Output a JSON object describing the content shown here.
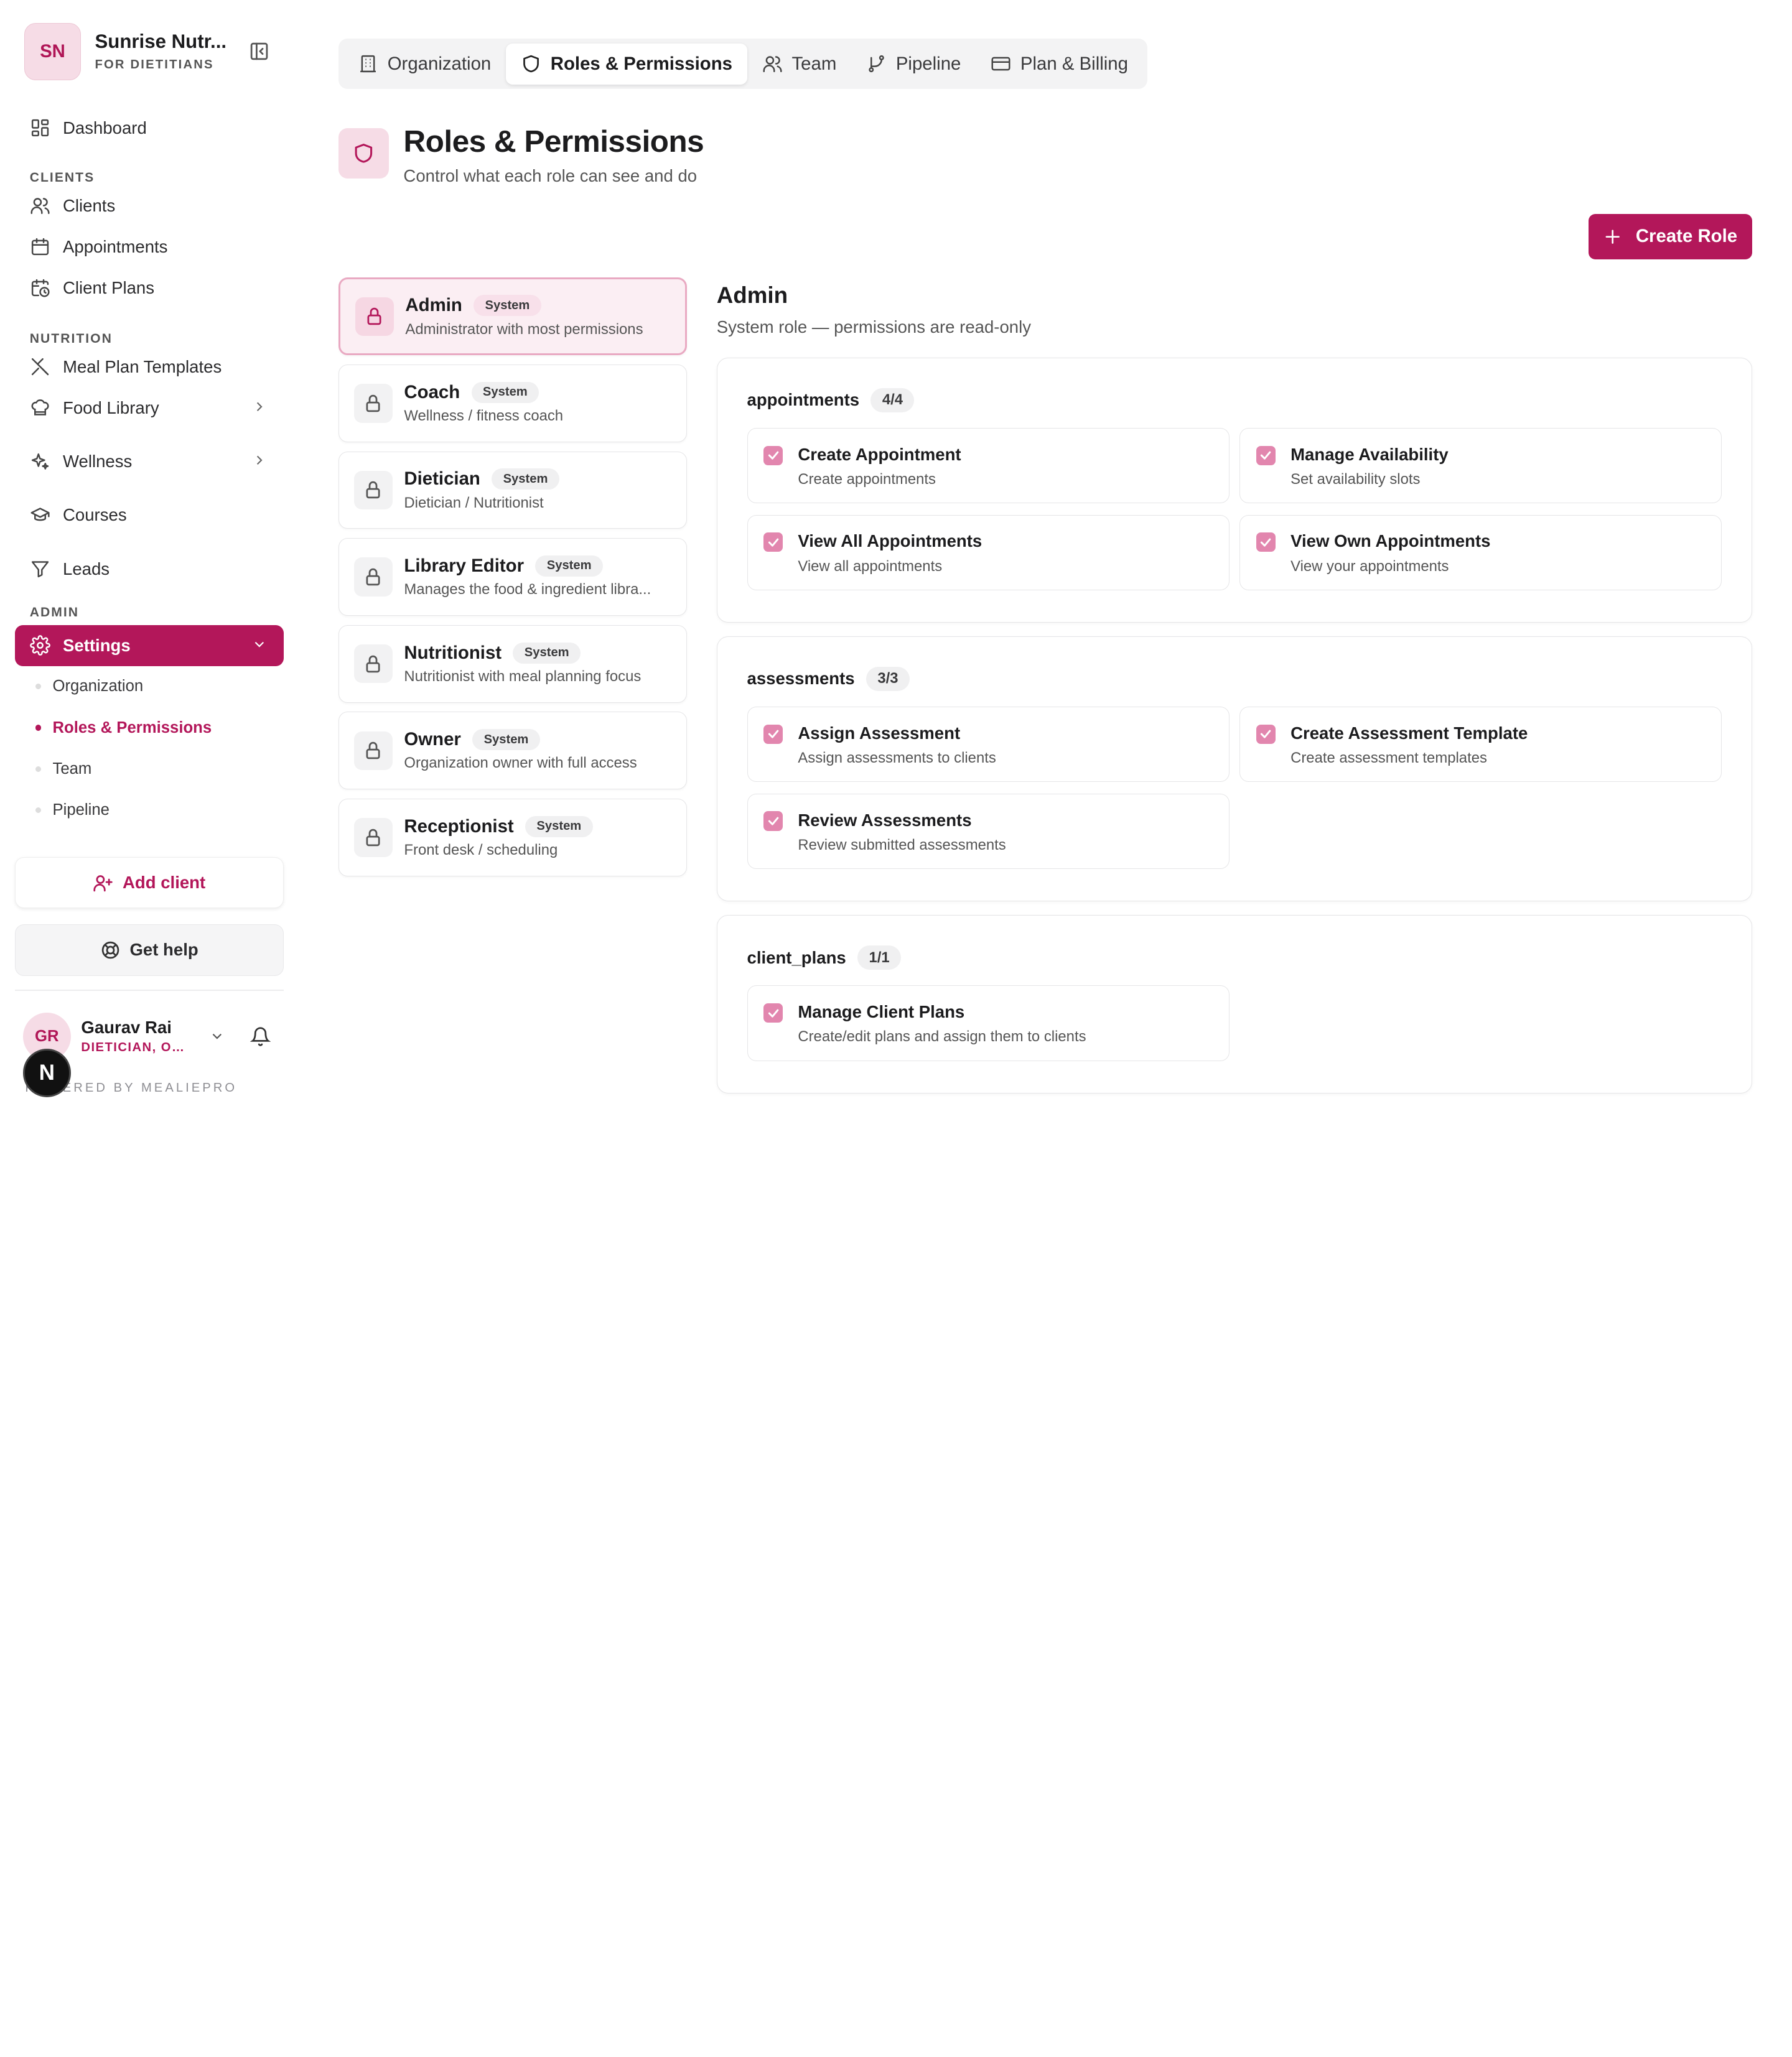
{
  "brand": {
    "initials": "SN",
    "name": "Sunrise Nutr...",
    "subtitle": "FOR DIETITIANS"
  },
  "nav": {
    "dashboard": "Dashboard",
    "clients_label": "CLIENTS",
    "clients": "Clients",
    "appointments": "Appointments",
    "client_plans": "Client Plans",
    "nutrition_label": "NUTRITION",
    "meal_plan_templates": "Meal Plan Templates",
    "food_library": "Food Library",
    "wellness": "Wellness",
    "courses": "Courses",
    "leads": "Leads",
    "admin_label": "ADMIN",
    "settings": "Settings",
    "sub": {
      "organization": "Organization",
      "roles": "Roles & Permissions",
      "team": "Team",
      "pipeline": "Pipeline"
    }
  },
  "sidebar_buttons": {
    "add_client": "Add client",
    "get_help": "Get help"
  },
  "user": {
    "initials": "GR",
    "name": "Gaurav Rai",
    "role": "DIETICIAN, OW..."
  },
  "powered_by": "POWERED BY MEALIEPRO",
  "next_badge": "N",
  "tabs": [
    "Organization",
    "Roles & Permissions",
    "Team",
    "Pipeline",
    "Plan & Billing"
  ],
  "page": {
    "title": "Roles & Permissions",
    "subtitle": "Control what each role can see and do"
  },
  "create_role": "Create Role",
  "roles": [
    {
      "name": "Admin",
      "badge": "System",
      "desc": "Administrator with most permissions"
    },
    {
      "name": "Coach",
      "badge": "System",
      "desc": "Wellness / fitness coach"
    },
    {
      "name": "Dietician",
      "badge": "System",
      "desc": "Dietician / Nutritionist"
    },
    {
      "name": "Library Editor",
      "badge": "System",
      "desc": "Manages the food & ingredient libra..."
    },
    {
      "name": "Nutritionist",
      "badge": "System",
      "desc": "Nutritionist with meal planning focus"
    },
    {
      "name": "Owner",
      "badge": "System",
      "desc": "Organization owner with full access"
    },
    {
      "name": "Receptionist",
      "badge": "System",
      "desc": "Front desk / scheduling"
    }
  ],
  "detail": {
    "title": "Admin",
    "subtitle": "System role — permissions are read-only"
  },
  "groups": [
    {
      "name": "appointments",
      "count": "4/4",
      "perms": [
        {
          "name": "Create Appointment",
          "desc": "Create appointments"
        },
        {
          "name": "Manage Availability",
          "desc": "Set availability slots"
        },
        {
          "name": "View All Appointments",
          "desc": "View all appointments"
        },
        {
          "name": "View Own Appointments",
          "desc": "View your appointments"
        }
      ]
    },
    {
      "name": "assessments",
      "count": "3/3",
      "perms": [
        {
          "name": "Assign Assessment",
          "desc": "Assign assessments to clients"
        },
        {
          "name": "Create Assessment Template",
          "desc": "Create assessment templates"
        },
        {
          "name": "Review Assessments",
          "desc": "Review submitted assessments"
        }
      ]
    },
    {
      "name": "client_plans",
      "count": "1/1",
      "perms": [
        {
          "name": "Manage Client Plans",
          "desc": "Create/edit plans and assign them to clients"
        }
      ]
    }
  ],
  "colors": {
    "accent": "#b3175a",
    "accent_soft": "#f6dce6",
    "checkbox": "#e286ae"
  }
}
